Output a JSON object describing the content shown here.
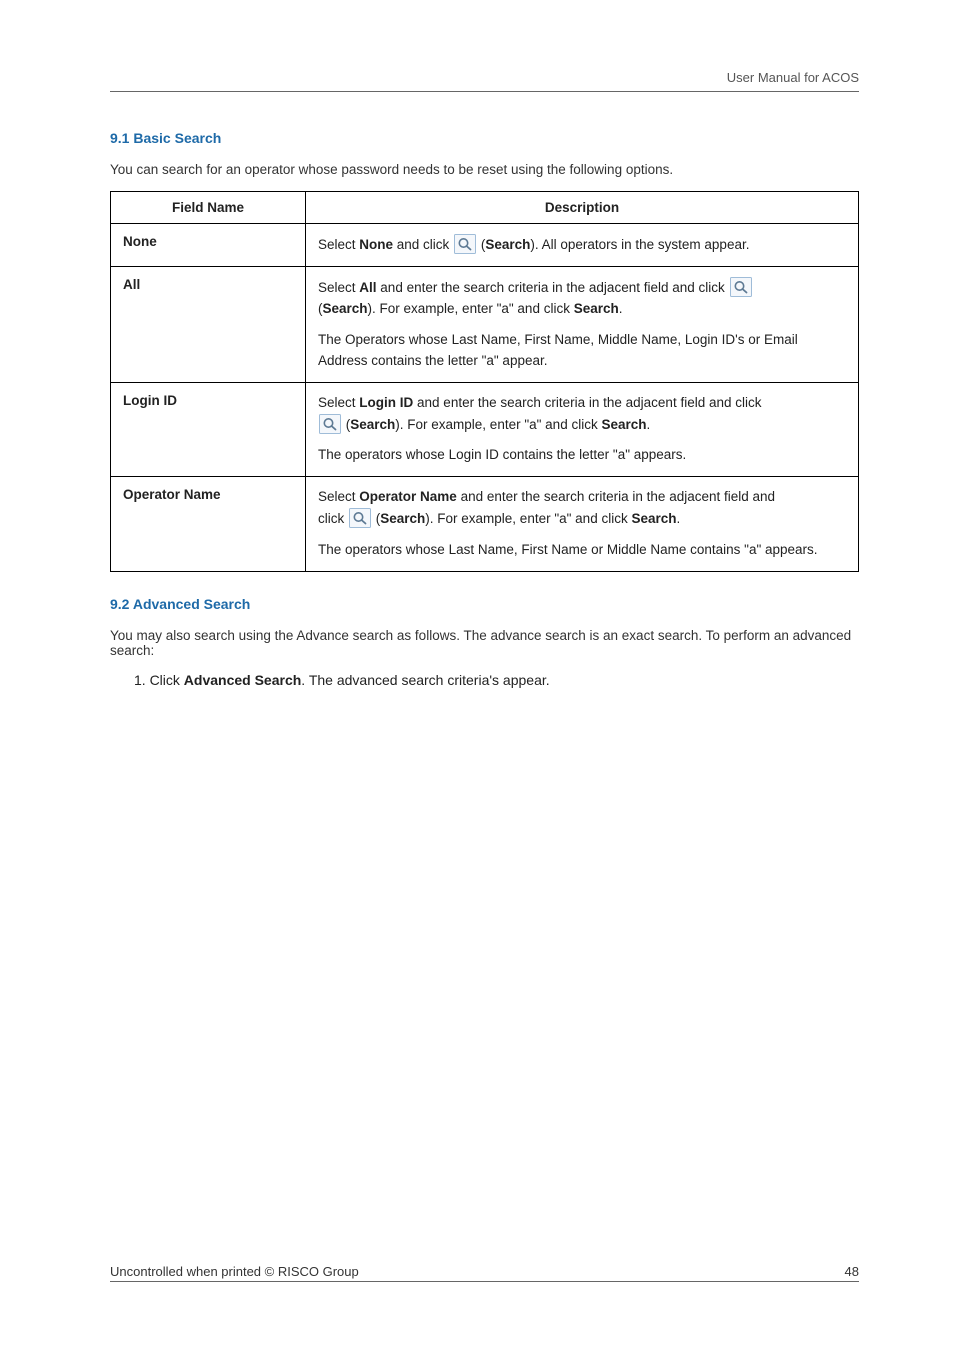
{
  "header": {
    "title": "User Manual for ACOS"
  },
  "sections": {
    "s1": {
      "num_title": "9.1  Basic Search",
      "lead": "You can search for an operator whose password needs to be reset using the following options."
    },
    "s2": {
      "num_title": "9.2  Advanced Search",
      "lead": "You may also search using the Advance search as follows. The advance search is an exact search. To perform an advanced search:",
      "step_prefix": "1.   Click ",
      "step_bold": "Advanced Search",
      "step_suffix": ". The advanced search criteria's appear."
    }
  },
  "table": {
    "head": {
      "field": "Field Name",
      "desc": "Description"
    },
    "none": {
      "field": "None",
      "d1a": "Select ",
      "d1b": "None",
      "d1c": " and click ",
      "d1d": " (",
      "d1e": "Search",
      "d1f": "). All operators in the system appear."
    },
    "all": {
      "field": "All",
      "d1a": "Select ",
      "d1b": "All",
      "d1c": " and enter the search criteria in the adjacent field and click ",
      "d2a": " (",
      "d2b": "Search",
      "d2c": "). For example, enter \"a\" and click ",
      "d2d": "Search",
      "d2e": ".",
      "d3": "The Operators whose Last Name, First Name, Middle Name, Login ID's or Email Address contains the letter \"a\" appear."
    },
    "login": {
      "field": "Login ID",
      "d1a": "Select ",
      "d1b": "Login ID",
      "d1c": " and enter the search criteria in the adjacent field and click",
      "d2a": " (",
      "d2b": "Search",
      "d2c": "). For example, enter \"a\" and click ",
      "d2d": "Search",
      "d2e": ".",
      "d3": "The operators whose Login ID contains the letter \"a\" appears."
    },
    "op": {
      "field": "Operator Name",
      "d1a": "Select ",
      "d1b": "Operator Name",
      "d1c": " and enter the search criteria in the adjacent field and",
      "d2a": "click ",
      "d2b": " (",
      "d2c": "Search",
      "d2d": "). For example, enter \"a\" and click ",
      "d2e": "Search",
      "d2f": ".",
      "d3": "The operators whose Last Name, First Name or Middle Name contains \"a\" appears."
    }
  },
  "footer": {
    "left": "Uncontrolled when printed © RISCO Group",
    "right": "48"
  }
}
